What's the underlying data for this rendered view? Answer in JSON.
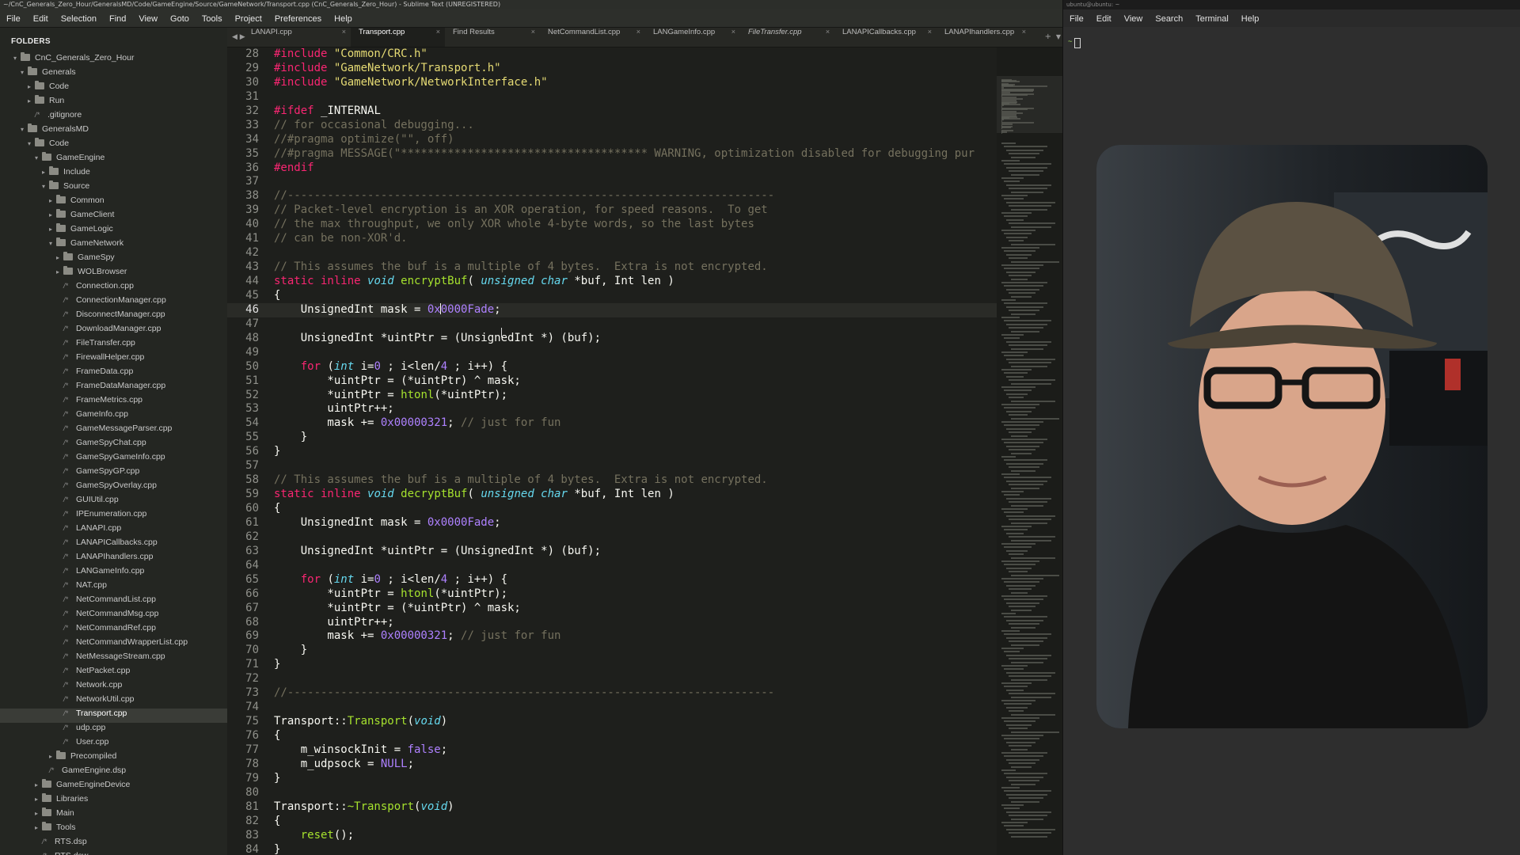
{
  "title_bar": {
    "text": "~/CnC_Generals_Zero_Hour/GeneralsMD/Code/GameEngine/Source/GameNetwork/Transport.cpp (CnC_Generals_Zero_Hour) - Sublime Text (UNREGISTERED)"
  },
  "menu": [
    "File",
    "Edit",
    "Selection",
    "Find",
    "View",
    "Goto",
    "Tools",
    "Project",
    "Preferences",
    "Help"
  ],
  "sidebar": {
    "heading": "FOLDERS",
    "items": [
      {
        "label": "CnC_Generals_Zero_Hour",
        "type": "folder",
        "depth": 0,
        "open": true
      },
      {
        "label": "Generals",
        "type": "folder",
        "depth": 1,
        "open": true
      },
      {
        "label": "Code",
        "type": "folder",
        "depth": 2,
        "open": false
      },
      {
        "label": "Run",
        "type": "folder",
        "depth": 2,
        "open": false
      },
      {
        "label": ".gitignore",
        "type": "file",
        "depth": 2
      },
      {
        "label": "GeneralsMD",
        "type": "folder",
        "depth": 1,
        "open": true
      },
      {
        "label": "Code",
        "type": "folder",
        "depth": 2,
        "open": true
      },
      {
        "label": "GameEngine",
        "type": "folder",
        "depth": 3,
        "open": true
      },
      {
        "label": "Include",
        "type": "folder",
        "depth": 4,
        "open": false
      },
      {
        "label": "Source",
        "type": "folder",
        "depth": 4,
        "open": true
      },
      {
        "label": "Common",
        "type": "folder",
        "depth": 5,
        "open": false
      },
      {
        "label": "GameClient",
        "type": "folder",
        "depth": 5,
        "open": false
      },
      {
        "label": "GameLogic",
        "type": "folder",
        "depth": 5,
        "open": false
      },
      {
        "label": "GameNetwork",
        "type": "folder",
        "depth": 5,
        "open": true
      },
      {
        "label": "GameSpy",
        "type": "folder",
        "depth": 6,
        "open": false
      },
      {
        "label": "WOLBrowser",
        "type": "folder",
        "depth": 6,
        "open": false
      },
      {
        "label": "Connection.cpp",
        "type": "file",
        "depth": 6
      },
      {
        "label": "ConnectionManager.cpp",
        "type": "file",
        "depth": 6
      },
      {
        "label": "DisconnectManager.cpp",
        "type": "file",
        "depth": 6
      },
      {
        "label": "DownloadManager.cpp",
        "type": "file",
        "depth": 6
      },
      {
        "label": "FileTransfer.cpp",
        "type": "file",
        "depth": 6
      },
      {
        "label": "FirewallHelper.cpp",
        "type": "file",
        "depth": 6
      },
      {
        "label": "FrameData.cpp",
        "type": "file",
        "depth": 6
      },
      {
        "label": "FrameDataManager.cpp",
        "type": "file",
        "depth": 6
      },
      {
        "label": "FrameMetrics.cpp",
        "type": "file",
        "depth": 6
      },
      {
        "label": "GameInfo.cpp",
        "type": "file",
        "depth": 6
      },
      {
        "label": "GameMessageParser.cpp",
        "type": "file",
        "depth": 6
      },
      {
        "label": "GameSpyChat.cpp",
        "type": "file",
        "depth": 6
      },
      {
        "label": "GameSpyGameInfo.cpp",
        "type": "file",
        "depth": 6
      },
      {
        "label": "GameSpyGP.cpp",
        "type": "file",
        "depth": 6
      },
      {
        "label": "GameSpyOverlay.cpp",
        "type": "file",
        "depth": 6
      },
      {
        "label": "GUIUtil.cpp",
        "type": "file",
        "depth": 6
      },
      {
        "label": "IPEnumeration.cpp",
        "type": "file",
        "depth": 6
      },
      {
        "label": "LANAPI.cpp",
        "type": "file",
        "depth": 6
      },
      {
        "label": "LANAPICallbacks.cpp",
        "type": "file",
        "depth": 6
      },
      {
        "label": "LANAPIhandlers.cpp",
        "type": "file",
        "depth": 6
      },
      {
        "label": "LANGameInfo.cpp",
        "type": "file",
        "depth": 6
      },
      {
        "label": "NAT.cpp",
        "type": "file",
        "depth": 6
      },
      {
        "label": "NetCommandList.cpp",
        "type": "file",
        "depth": 6
      },
      {
        "label": "NetCommandMsg.cpp",
        "type": "file",
        "depth": 6
      },
      {
        "label": "NetCommandRef.cpp",
        "type": "file",
        "depth": 6
      },
      {
        "label": "NetCommandWrapperList.cpp",
        "type": "file",
        "depth": 6
      },
      {
        "label": "NetMessageStream.cpp",
        "type": "file",
        "depth": 6
      },
      {
        "label": "NetPacket.cpp",
        "type": "file",
        "depth": 6
      },
      {
        "label": "Network.cpp",
        "type": "file",
        "depth": 6
      },
      {
        "label": "NetworkUtil.cpp",
        "type": "file",
        "depth": 6
      },
      {
        "label": "Transport.cpp",
        "type": "file",
        "depth": 6,
        "selected": true
      },
      {
        "label": "udp.cpp",
        "type": "file",
        "depth": 6
      },
      {
        "label": "User.cpp",
        "type": "file",
        "depth": 6
      },
      {
        "label": "Precompiled",
        "type": "folder",
        "depth": 5,
        "open": false
      },
      {
        "label": "GameEngine.dsp",
        "type": "file",
        "depth": 4
      },
      {
        "label": "GameEngineDevice",
        "type": "folder",
        "depth": 3,
        "open": false
      },
      {
        "label": "Libraries",
        "type": "folder",
        "depth": 3,
        "open": false
      },
      {
        "label": "Main",
        "type": "folder",
        "depth": 3,
        "open": false
      },
      {
        "label": "Tools",
        "type": "folder",
        "depth": 3,
        "open": false
      },
      {
        "label": "RTS.dsp",
        "type": "file",
        "depth": 3
      },
      {
        "label": "RTS.dsw",
        "type": "file",
        "depth": 3
      }
    ]
  },
  "tabs": [
    {
      "label": "LANAPI.cpp",
      "active": false,
      "italic": false
    },
    {
      "label": "Transport.cpp",
      "active": true,
      "italic": false
    },
    {
      "label": "Find Results",
      "active": false,
      "italic": false
    },
    {
      "label": "NetCommandList.cpp",
      "active": false,
      "italic": false
    },
    {
      "label": "LANGameInfo.cpp",
      "active": false,
      "italic": false
    },
    {
      "label": "FileTransfer.cpp",
      "active": false,
      "italic": true
    },
    {
      "label": "LANAPICallbacks.cpp",
      "active": false,
      "italic": false
    },
    {
      "label": "LANAPIhandlers.cpp",
      "active": false,
      "italic": false
    }
  ],
  "editor": {
    "current_line": 46,
    "lines": [
      {
        "n": 28,
        "tokens": [
          [
            "mac",
            "#include "
          ],
          [
            "str",
            "\"Common/CRC.h\""
          ]
        ]
      },
      {
        "n": 29,
        "tokens": [
          [
            "mac",
            "#include "
          ],
          [
            "str",
            "\"GameNetwork/Transport.h\""
          ]
        ]
      },
      {
        "n": 30,
        "tokens": [
          [
            "mac",
            "#include "
          ],
          [
            "str",
            "\"GameNetwork/NetworkInterface.h\""
          ]
        ]
      },
      {
        "n": 31,
        "tokens": []
      },
      {
        "n": 32,
        "tokens": [
          [
            "mac",
            "#ifdef "
          ],
          [
            "pl",
            "_INTERNAL"
          ]
        ]
      },
      {
        "n": 33,
        "tokens": [
          [
            "cm",
            "// for occasional debugging..."
          ]
        ]
      },
      {
        "n": 34,
        "tokens": [
          [
            "cm",
            "//#pragma optimize(\"\", off)"
          ]
        ]
      },
      {
        "n": 35,
        "tokens": [
          [
            "cm",
            "//#pragma MESSAGE(\"************************************* WARNING, optimization disabled for debugging pur"
          ]
        ]
      },
      {
        "n": 36,
        "tokens": [
          [
            "mac",
            "#endif"
          ]
        ]
      },
      {
        "n": 37,
        "tokens": []
      },
      {
        "n": 38,
        "tokens": [
          [
            "cm",
            "//-------------------------------------------------------------------------"
          ]
        ]
      },
      {
        "n": 39,
        "tokens": [
          [
            "cm",
            "// Packet-level encryption is an XOR operation, for speed reasons.  To get"
          ]
        ]
      },
      {
        "n": 40,
        "tokens": [
          [
            "cm",
            "// the max throughput, we only XOR whole 4-byte words, so the last bytes"
          ]
        ]
      },
      {
        "n": 41,
        "tokens": [
          [
            "cm",
            "// can be non-XOR'd."
          ]
        ]
      },
      {
        "n": 42,
        "tokens": []
      },
      {
        "n": 43,
        "tokens": [
          [
            "cm",
            "// This assumes the buf is a multiple of 4 bytes.  Extra is not encrypted."
          ]
        ]
      },
      {
        "n": 44,
        "tokens": [
          [
            "kw",
            "static inline "
          ],
          [
            "ty",
            "void "
          ],
          [
            "fn",
            "encryptBuf"
          ],
          [
            "pl",
            "( "
          ],
          [
            "ty",
            "unsigned char "
          ],
          [
            "pl",
            "*buf, Int len )"
          ]
        ]
      },
      {
        "n": 45,
        "tokens": [
          [
            "pl",
            "{"
          ]
        ]
      },
      {
        "n": 46,
        "tokens": [
          [
            "pl",
            "    UnsignedInt mask = "
          ],
          [
            "num",
            "0x"
          ],
          [
            "cursor",
            ""
          ],
          [
            "num",
            "0000Fade"
          ],
          [
            "pl",
            ";"
          ]
        ]
      },
      {
        "n": 47,
        "tokens": []
      },
      {
        "n": 48,
        "tokens": [
          [
            "pl",
            "    UnsignedInt *uintPtr = (UnsignedInt *) (buf);"
          ]
        ]
      },
      {
        "n": 49,
        "tokens": []
      },
      {
        "n": 50,
        "tokens": [
          [
            "kw",
            "    for "
          ],
          [
            "pl",
            "("
          ],
          [
            "ty",
            "int "
          ],
          [
            "pl",
            "i="
          ],
          [
            "num",
            "0"
          ],
          [
            "pl",
            " ; i<len/"
          ],
          [
            "num",
            "4"
          ],
          [
            "pl",
            " ; i++) {"
          ]
        ]
      },
      {
        "n": 51,
        "tokens": [
          [
            "pl",
            "        *uintPtr = (*uintPtr) ^ mask;"
          ]
        ]
      },
      {
        "n": 52,
        "tokens": [
          [
            "pl",
            "        *uintPtr = "
          ],
          [
            "fn",
            "htonl"
          ],
          [
            "pl",
            "(*uintPtr);"
          ]
        ]
      },
      {
        "n": 53,
        "tokens": [
          [
            "pl",
            "        uintPtr++;"
          ]
        ]
      },
      {
        "n": 54,
        "tokens": [
          [
            "pl",
            "        mask += "
          ],
          [
            "num",
            "0x00000321"
          ],
          [
            "pl",
            "; "
          ],
          [
            "cm",
            "// just for fun"
          ]
        ]
      },
      {
        "n": 55,
        "tokens": [
          [
            "pl",
            "    }"
          ]
        ]
      },
      {
        "n": 56,
        "tokens": [
          [
            "pl",
            "}"
          ]
        ]
      },
      {
        "n": 57,
        "tokens": []
      },
      {
        "n": 58,
        "tokens": [
          [
            "cm",
            "// This assumes the buf is a multiple of 4 bytes.  Extra is not encrypted."
          ]
        ]
      },
      {
        "n": 59,
        "tokens": [
          [
            "kw",
            "static inline "
          ],
          [
            "ty",
            "void "
          ],
          [
            "fn",
            "decryptBuf"
          ],
          [
            "pl",
            "( "
          ],
          [
            "ty",
            "unsigned char "
          ],
          [
            "pl",
            "*buf, Int len )"
          ]
        ]
      },
      {
        "n": 60,
        "tokens": [
          [
            "pl",
            "{"
          ]
        ]
      },
      {
        "n": 61,
        "tokens": [
          [
            "pl",
            "    UnsignedInt mask = "
          ],
          [
            "num",
            "0x0000Fade"
          ],
          [
            "pl",
            ";"
          ]
        ]
      },
      {
        "n": 62,
        "tokens": []
      },
      {
        "n": 63,
        "tokens": [
          [
            "pl",
            "    UnsignedInt *uintPtr = (UnsignedInt *) (buf);"
          ]
        ]
      },
      {
        "n": 64,
        "tokens": []
      },
      {
        "n": 65,
        "tokens": [
          [
            "kw",
            "    for "
          ],
          [
            "pl",
            "("
          ],
          [
            "ty",
            "int "
          ],
          [
            "pl",
            "i="
          ],
          [
            "num",
            "0"
          ],
          [
            "pl",
            " ; i<len/"
          ],
          [
            "num",
            "4"
          ],
          [
            "pl",
            " ; i++) {"
          ]
        ]
      },
      {
        "n": 66,
        "tokens": [
          [
            "pl",
            "        *uintPtr = "
          ],
          [
            "fn",
            "htonl"
          ],
          [
            "pl",
            "(*uintPtr);"
          ]
        ]
      },
      {
        "n": 67,
        "tokens": [
          [
            "pl",
            "        *uintPtr = (*uintPtr) ^ mask;"
          ]
        ]
      },
      {
        "n": 68,
        "tokens": [
          [
            "pl",
            "        uintPtr++;"
          ]
        ]
      },
      {
        "n": 69,
        "tokens": [
          [
            "pl",
            "        mask += "
          ],
          [
            "num",
            "0x00000321"
          ],
          [
            "pl",
            "; "
          ],
          [
            "cm",
            "// just for fun"
          ]
        ]
      },
      {
        "n": 70,
        "tokens": [
          [
            "pl",
            "    }"
          ]
        ]
      },
      {
        "n": 71,
        "tokens": [
          [
            "pl",
            "}"
          ]
        ]
      },
      {
        "n": 72,
        "tokens": []
      },
      {
        "n": 73,
        "tokens": [
          [
            "cm",
            "//-------------------------------------------------------------------------"
          ]
        ]
      },
      {
        "n": 74,
        "tokens": []
      },
      {
        "n": 75,
        "tokens": [
          [
            "pl",
            "Transport::"
          ],
          [
            "fn",
            "Transport"
          ],
          [
            "pl",
            "("
          ],
          [
            "ty",
            "void"
          ],
          [
            "pl",
            ")"
          ]
        ]
      },
      {
        "n": 76,
        "tokens": [
          [
            "pl",
            "{"
          ]
        ]
      },
      {
        "n": 77,
        "tokens": [
          [
            "pl",
            "    m_winsockInit = "
          ],
          [
            "num",
            "false"
          ],
          [
            "pl",
            ";"
          ]
        ]
      },
      {
        "n": 78,
        "tokens": [
          [
            "pl",
            "    m_udpsock = "
          ],
          [
            "num",
            "NULL"
          ],
          [
            "pl",
            ";"
          ]
        ]
      },
      {
        "n": 79,
        "tokens": [
          [
            "pl",
            "}"
          ]
        ]
      },
      {
        "n": 80,
        "tokens": []
      },
      {
        "n": 81,
        "tokens": [
          [
            "pl",
            "Transport::"
          ],
          [
            "fn",
            "~Transport"
          ],
          [
            "pl",
            "("
          ],
          [
            "ty",
            "void"
          ],
          [
            "pl",
            ")"
          ]
        ]
      },
      {
        "n": 82,
        "tokens": [
          [
            "pl",
            "{"
          ]
        ]
      },
      {
        "n": 83,
        "tokens": [
          [
            "pl",
            "    "
          ],
          [
            "fn",
            "reset"
          ],
          [
            "pl",
            "();"
          ]
        ]
      },
      {
        "n": 84,
        "tokens": [
          [
            "pl",
            "}"
          ]
        ]
      }
    ]
  },
  "terminal": {
    "title": "ubuntu@ubuntu: ~",
    "menu": [
      "File",
      "Edit",
      "View",
      "Search",
      "Terminal",
      "Help"
    ],
    "prompt": "~"
  }
}
